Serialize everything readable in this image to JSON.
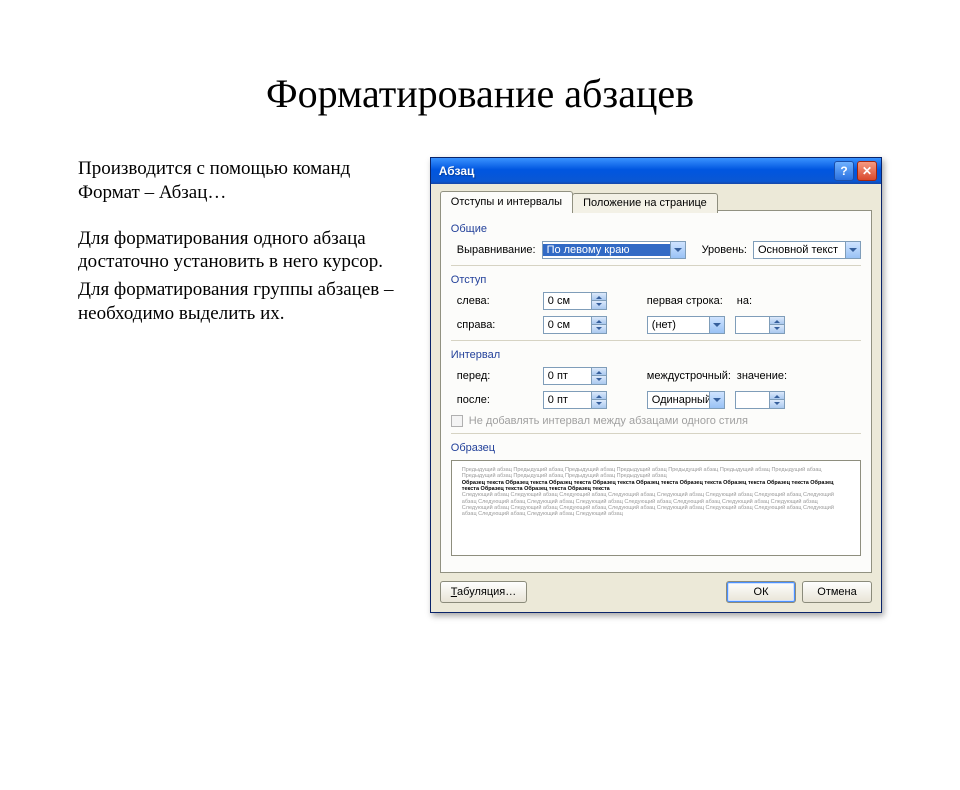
{
  "slide": {
    "title": "Форматирование абзацев",
    "text1": "Производится с помощью команд Формат – Абзац…",
    "text2": "Для форматирования одного абзаца достаточно установить в него курсор.",
    "text3": "Для форматирования группы абзацев – необходимо выделить их."
  },
  "dialog": {
    "title": "Абзац",
    "tabs": {
      "tab1": "Отступы и интервалы",
      "tab2": "Положение на странице"
    },
    "general": {
      "heading": "Общие",
      "align_label": "Выравнивание:",
      "align_value": "По левому краю",
      "level_label": "Уровень:",
      "level_value": "Основной текст"
    },
    "indent": {
      "heading": "Отступ",
      "left_label": "слева:",
      "left_value": "0 см",
      "right_label": "справа:",
      "right_value": "0 см",
      "firstline_label": "первая строка:",
      "firstline_value": "(нет)",
      "on_label": "на:"
    },
    "interval": {
      "heading": "Интервал",
      "before_label": "перед:",
      "before_value": "0 пт",
      "after_label": "после:",
      "after_value": "0 пт",
      "linespacing_label": "междустрочный:",
      "linespacing_value": "Одинарный",
      "value_label": "значение:",
      "checkbox_label": "Не добавлять интервал между абзацами одного стиля"
    },
    "preview": {
      "heading": "Образец",
      "prev_line": "Предыдущий абзац Предыдущий абзац Предыдущий абзац Предыдущий абзац Предыдущий абзац Предыдущий абзац Предыдущий абзац Предыдущий абзац Предыдущий абзац Предыдущий абзац Предыдущий абзац",
      "bold_line": "Образец текста Образец текста Образец текста Образец текста Образец текста Образец текста Образец текста Образец текста Образец текста Образец текста Образец текста Образец текста",
      "next_line": "Следующий абзац Следующий абзац Следующий абзац Следующий абзац Следующий абзац Следующий абзац Следующий абзац Следующий абзац Следующий абзац Следующий абзац Следующий абзац Следующий абзац Следующий абзац Следующий абзац Следующий абзац Следующий абзац Следующий абзац Следующий абзац Следующий абзац Следующий абзац Следующий абзац Следующий абзац Следующий абзац Следующий абзац Следующий абзац Следующий абзац"
    },
    "buttons": {
      "tabs": "Табуляция…",
      "ok": "ОК",
      "cancel": "Отмена"
    }
  }
}
